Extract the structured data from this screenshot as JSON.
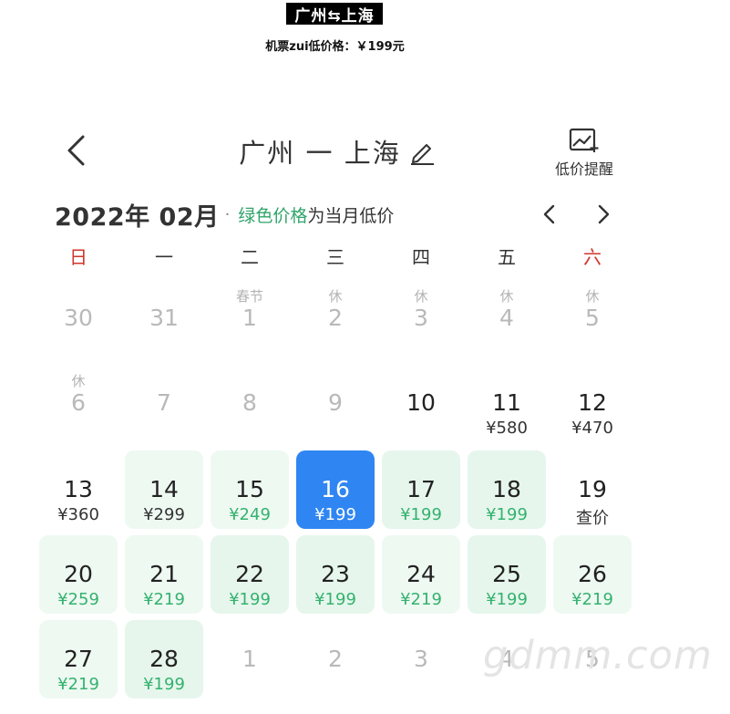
{
  "banner": {
    "title": "广州⇆上海",
    "subtitle": "机票zui低价格：￥199元"
  },
  "header": {
    "route": "广州 一 上海",
    "alert_label": "低价提醒"
  },
  "calendar_meta": {
    "month": "2022年 02月",
    "dot": "·",
    "legend_green": "绿色价格",
    "legend_rest": "为当月低价"
  },
  "weekdays": [
    "日",
    "一",
    "二",
    "三",
    "四",
    "五",
    "六"
  ],
  "days": [
    {
      "num": "30",
      "tag": "",
      "price": ""
    },
    {
      "num": "31",
      "tag": "",
      "price": ""
    },
    {
      "num": "1",
      "tag": "春节",
      "price": ""
    },
    {
      "num": "2",
      "tag": "休",
      "price": ""
    },
    {
      "num": "3",
      "tag": "休",
      "price": ""
    },
    {
      "num": "4",
      "tag": "休",
      "price": ""
    },
    {
      "num": "5",
      "tag": "休",
      "price": ""
    },
    {
      "num": "6",
      "tag": "休",
      "price": ""
    },
    {
      "num": "7",
      "tag": "",
      "price": ""
    },
    {
      "num": "8",
      "tag": "",
      "price": ""
    },
    {
      "num": "9",
      "tag": "",
      "price": ""
    },
    {
      "num": "10",
      "tag": "",
      "price": ""
    },
    {
      "num": "11",
      "tag": "",
      "price": "¥580"
    },
    {
      "num": "12",
      "tag": "",
      "price": "¥470"
    },
    {
      "num": "13",
      "tag": "",
      "price": "¥360"
    },
    {
      "num": "14",
      "tag": "",
      "price": "¥299"
    },
    {
      "num": "15",
      "tag": "",
      "price": "¥249"
    },
    {
      "num": "16",
      "tag": "",
      "price": "¥199"
    },
    {
      "num": "17",
      "tag": "",
      "price": "¥199"
    },
    {
      "num": "18",
      "tag": "",
      "price": "¥199"
    },
    {
      "num": "19",
      "tag": "",
      "price": "查价"
    },
    {
      "num": "20",
      "tag": "",
      "price": "¥259"
    },
    {
      "num": "21",
      "tag": "",
      "price": "¥219"
    },
    {
      "num": "22",
      "tag": "",
      "price": "¥199"
    },
    {
      "num": "23",
      "tag": "",
      "price": "¥199"
    },
    {
      "num": "24",
      "tag": "",
      "price": "¥219"
    },
    {
      "num": "25",
      "tag": "",
      "price": "¥199"
    },
    {
      "num": "26",
      "tag": "",
      "price": "¥219"
    },
    {
      "num": "27",
      "tag": "",
      "price": "¥219"
    },
    {
      "num": "28",
      "tag": "",
      "price": "¥199"
    },
    {
      "num": "1",
      "tag": "",
      "price": ""
    },
    {
      "num": "2",
      "tag": "",
      "price": ""
    },
    {
      "num": "3",
      "tag": "",
      "price": ""
    },
    {
      "num": "4",
      "tag": "",
      "price": ""
    },
    {
      "num": "5",
      "tag": "",
      "price": ""
    }
  ],
  "selected_day": "16",
  "colors": {
    "green": "#34b26e",
    "selected": "#2f86f2",
    "holiday_red": "#d0352b"
  },
  "watermark": "gdmm.com"
}
